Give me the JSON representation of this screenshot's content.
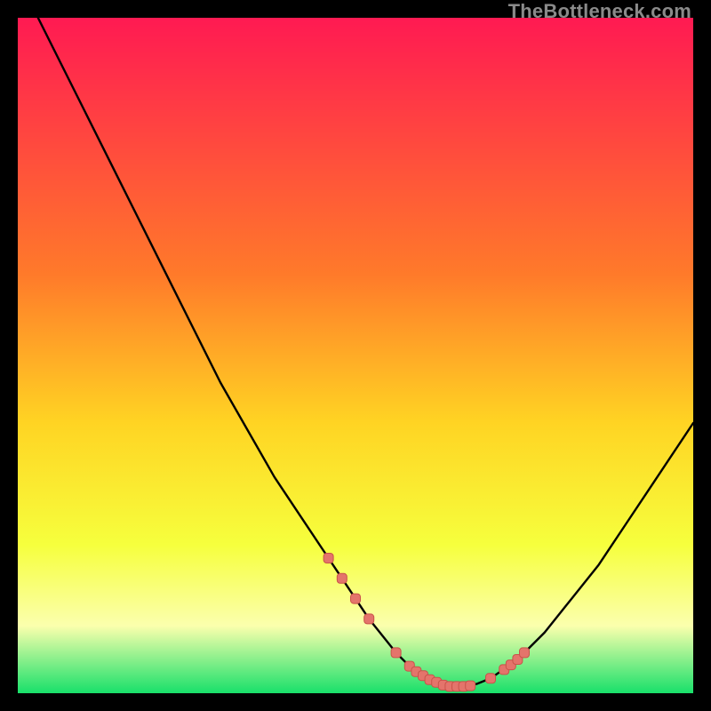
{
  "watermark": {
    "text": "TheBottleneck.com"
  },
  "colors": {
    "bg_black": "#000000",
    "grad_top": "#ff1a52",
    "grad_mid1": "#ff7a2a",
    "grad_mid2": "#ffd423",
    "grad_yellow": "#f6ff3d",
    "grad_lightyellow": "#fbffad",
    "grad_green": "#18e06a",
    "curve_black": "#000000",
    "marker_fill": "#e4746b",
    "marker_stroke": "#c9534a"
  },
  "chart_data": {
    "type": "line",
    "title": "",
    "xlabel": "",
    "ylabel": "",
    "xlim": [
      0,
      100
    ],
    "ylim": [
      0,
      100
    ],
    "grid": false,
    "legend": false,
    "series": [
      {
        "name": "bottleneck-curve",
        "x": [
          3,
          6,
          10,
          14,
          18,
          22,
          26,
          30,
          34,
          38,
          42,
          46,
          50,
          52,
          54,
          56,
          58,
          60,
          62,
          64,
          66,
          68,
          70,
          74,
          78,
          82,
          86,
          90,
          94,
          98,
          100
        ],
        "y": [
          100,
          94,
          86,
          78,
          70,
          62,
          54,
          46,
          39,
          32,
          26,
          20,
          14,
          11,
          8.5,
          6,
          4,
          2.6,
          1.6,
          1,
          1,
          1.4,
          2.2,
          5,
          9,
          14,
          19,
          25,
          31,
          37,
          40
        ]
      }
    ],
    "markers": {
      "name": "highlight-points-near-minimum",
      "x": [
        46,
        48,
        50,
        52,
        56,
        58,
        59,
        60,
        61,
        62,
        63,
        64,
        65,
        66,
        67,
        70,
        72,
        73,
        74,
        75
      ],
      "y": [
        20.0,
        17.0,
        14.0,
        11.0,
        6.0,
        4.0,
        3.2,
        2.6,
        2.0,
        1.6,
        1.2,
        1.0,
        1.0,
        1.0,
        1.1,
        2.2,
        3.5,
        4.2,
        5.0,
        6.0
      ]
    }
  }
}
